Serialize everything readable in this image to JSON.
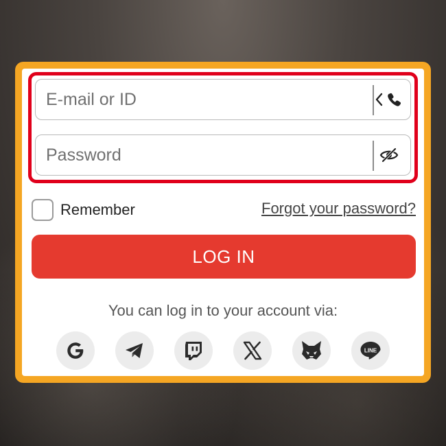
{
  "form": {
    "email_placeholder": "E-mail or ID",
    "password_placeholder": "Password",
    "remember_label": "Remember",
    "remember_checked": false,
    "forgot_link": "Forgot your password?",
    "login_button": "LOG IN",
    "via_text": "You can log in to your account via:"
  },
  "icons": {
    "phone_toggle": "chevron-phone-icon",
    "password_visibility": "eye-slash-icon"
  },
  "socials": [
    {
      "name": "google",
      "icon": "google-icon"
    },
    {
      "name": "telegram",
      "icon": "telegram-icon"
    },
    {
      "name": "twitch",
      "icon": "twitch-icon"
    },
    {
      "name": "x",
      "icon": "x-icon"
    },
    {
      "name": "metamask",
      "icon": "metamask-icon"
    },
    {
      "name": "line",
      "icon": "line-icon",
      "label": "LINE"
    }
  ],
  "colors": {
    "frame": "#f5a623",
    "highlight_border": "#e0001b",
    "login_button": "#e53a2f"
  }
}
